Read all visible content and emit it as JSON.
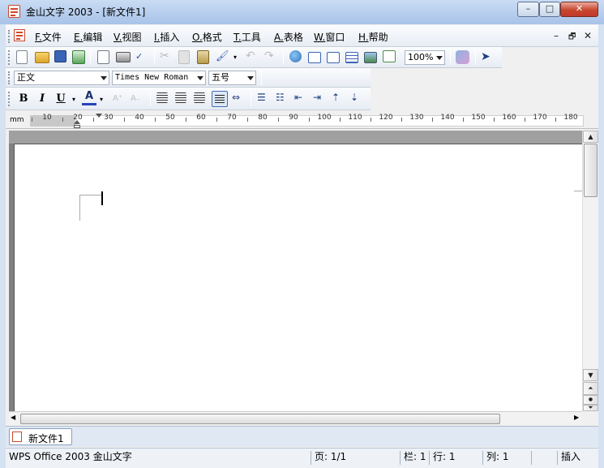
{
  "window": {
    "title": "金山文字 2003 - [新文件1]",
    "minimize": "–",
    "maximize": "□",
    "close": "✕"
  },
  "menu": {
    "items": [
      {
        "key": "F.",
        "label": "文件"
      },
      {
        "key": "E.",
        "label": "编辑"
      },
      {
        "key": "V.",
        "label": "视图"
      },
      {
        "key": "I.",
        "label": "插入"
      },
      {
        "key": "O.",
        "label": "格式"
      },
      {
        "key": "T.",
        "label": "工具"
      },
      {
        "key": "A.",
        "label": "表格"
      },
      {
        "key": "W.",
        "label": "窗口"
      },
      {
        "key": "H.",
        "label": "帮助"
      }
    ],
    "mdi_min": "–",
    "mdi_restore": "🗗",
    "mdi_close": "✕"
  },
  "toolbar": {
    "zoom": "100%",
    "style": "正文",
    "font": "Times New Roman",
    "size": "五号",
    "bold": "B",
    "italic": "I",
    "underline": "U",
    "font_color": "A"
  },
  "ruler": {
    "unit": "mm",
    "labels": [
      "10",
      "20",
      "30",
      "40",
      "50",
      "60",
      "70",
      "80",
      "90",
      "100",
      "110",
      "120",
      "130",
      "140",
      "150",
      "160",
      "170",
      "180"
    ]
  },
  "tabs": [
    {
      "label": "新文件1"
    }
  ],
  "status": {
    "app": "WPS Office 2003 金山文字",
    "page": "页: 1/1",
    "column": "栏: 1",
    "row": "行: 1",
    "col": "列: 1",
    "mode": "插入"
  },
  "colors": {
    "title_bar": "#b8cfee",
    "close_button": "#c8462f",
    "workspace_grey": "#808080"
  }
}
